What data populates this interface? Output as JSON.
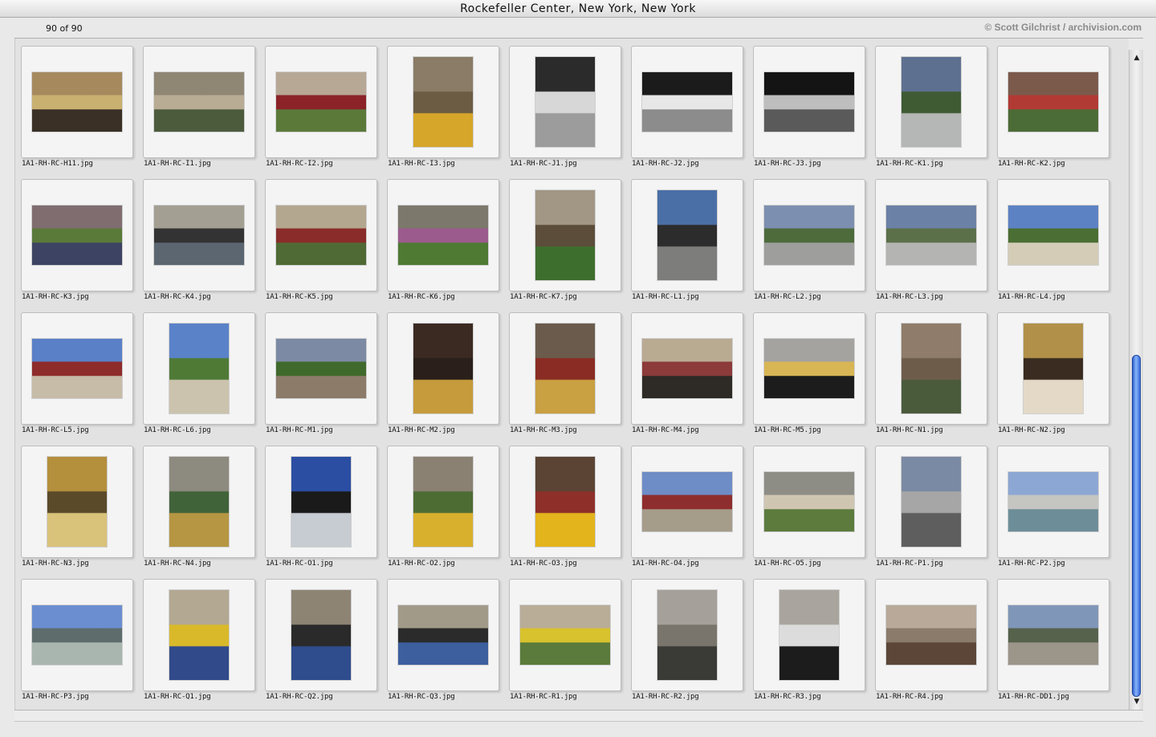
{
  "window": {
    "title": "Rockefeller Center, New York, New York"
  },
  "header": {
    "count": "90 of 90",
    "copyright": "© Scott Gilchrist / archivision.com"
  },
  "scrollbar": {
    "up_icon": "scroll-up-arrow-icon",
    "down_icon": "scroll-down-arrow-icon",
    "position": 0.82
  },
  "thumbnails": [
    {
      "filename": "1A1-RH-RC-H11.jpg",
      "orientation": "landscape",
      "colors": [
        "#a68a5e",
        "#3a3025",
        "#c9b070"
      ]
    },
    {
      "filename": "1A1-RH-RC-I1.jpg",
      "orientation": "landscape",
      "colors": [
        "#8f8674",
        "#4d5b3d",
        "#b9ac94"
      ]
    },
    {
      "filename": "1A1-RH-RC-I2.jpg",
      "orientation": "landscape",
      "colors": [
        "#b7a895",
        "#5b7a3a",
        "#8b2328"
      ]
    },
    {
      "filename": "1A1-RH-RC-I3.jpg",
      "orientation": "portrait",
      "colors": [
        "#8a7c66",
        "#d5a629",
        "#6b5c43"
      ]
    },
    {
      "filename": "1A1-RH-RC-J1.jpg",
      "orientation": "portrait",
      "colors": [
        "#2b2b2b",
        "#9c9c9c",
        "#d7d7d7"
      ]
    },
    {
      "filename": "1A1-RH-RC-J2.jpg",
      "orientation": "landscape",
      "colors": [
        "#1b1b1b",
        "#8c8c8c",
        "#e7e7e7"
      ]
    },
    {
      "filename": "1A1-RH-RC-J3.jpg",
      "orientation": "landscape",
      "colors": [
        "#141414",
        "#5a5a5a",
        "#bebebe"
      ]
    },
    {
      "filename": "1A1-RH-RC-K1.jpg",
      "orientation": "portrait",
      "colors": [
        "#5e7090",
        "#b5b6b6",
        "#3e5b33"
      ]
    },
    {
      "filename": "1A1-RH-RC-K2.jpg",
      "orientation": "landscape",
      "colors": [
        "#7c5a4b",
        "#4c6c37",
        "#b23a35"
      ]
    },
    {
      "filename": "1A1-RH-RC-K3.jpg",
      "orientation": "landscape",
      "colors": [
        "#7f6d6f",
        "#3d4463",
        "#5a7a3a"
      ]
    },
    {
      "filename": "1A1-RH-RC-K4.jpg",
      "orientation": "landscape",
      "colors": [
        "#a39f93",
        "#5b6671",
        "#333333"
      ]
    },
    {
      "filename": "1A1-RH-RC-K5.jpg",
      "orientation": "landscape",
      "colors": [
        "#b4a78f",
        "#4f6a35",
        "#8a2c2a"
      ]
    },
    {
      "filename": "1A1-RH-RC-K6.jpg",
      "orientation": "landscape",
      "colors": [
        "#7c786c",
        "#4e7a33",
        "#9c5b8d"
      ]
    },
    {
      "filename": "1A1-RH-RC-K7.jpg",
      "orientation": "portrait",
      "colors": [
        "#a29784",
        "#3e6e2e",
        "#5c4d3b"
      ]
    },
    {
      "filename": "1A1-RH-RC-L1.jpg",
      "orientation": "portrait",
      "colors": [
        "#4a6fa6",
        "#7d7d7c",
        "#2c2c2c"
      ]
    },
    {
      "filename": "1A1-RH-RC-L2.jpg",
      "orientation": "landscape",
      "colors": [
        "#7d8fb0",
        "#9e9f9c",
        "#4d6b3b"
      ]
    },
    {
      "filename": "1A1-RH-RC-L3.jpg",
      "orientation": "landscape",
      "colors": [
        "#6c81a6",
        "#b4b4b2",
        "#5b7049"
      ]
    },
    {
      "filename": "1A1-RH-RC-L4.jpg",
      "orientation": "landscape",
      "colors": [
        "#5d82c4",
        "#d4ccb7",
        "#4a6e33"
      ]
    },
    {
      "filename": "1A1-RH-RC-L5.jpg",
      "orientation": "landscape",
      "colors": [
        "#5a80c8",
        "#c7bca8",
        "#8e2b2b"
      ]
    },
    {
      "filename": "1A1-RH-RC-L6.jpg",
      "orientation": "portrait",
      "colors": [
        "#5a82c9",
        "#cbc3ad",
        "#4f7a36"
      ]
    },
    {
      "filename": "1A1-RH-RC-M1.jpg",
      "orientation": "landscape",
      "colors": [
        "#7c8aa3",
        "#8d7b69",
        "#3f6a2b"
      ]
    },
    {
      "filename": "1A1-RH-RC-M2.jpg",
      "orientation": "portrait",
      "colors": [
        "#3b2a22",
        "#c69b3b",
        "#2a1f1a"
      ]
    },
    {
      "filename": "1A1-RH-RC-M3.jpg",
      "orientation": "portrait",
      "colors": [
        "#6b5b4c",
        "#c9a042",
        "#8a2c24"
      ]
    },
    {
      "filename": "1A1-RH-RC-M4.jpg",
      "orientation": "landscape",
      "colors": [
        "#b9aa92",
        "#2e2a25",
        "#8c3a3a"
      ]
    },
    {
      "filename": "1A1-RH-RC-M5.jpg",
      "orientation": "landscape",
      "colors": [
        "#a5a3a0",
        "#1c1c1c",
        "#d8b655"
      ]
    },
    {
      "filename": "1A1-RH-RC-N1.jpg",
      "orientation": "portrait",
      "colors": [
        "#8f7c6a",
        "#4a5b3c",
        "#6e5c4b"
      ]
    },
    {
      "filename": "1A1-RH-RC-N2.jpg",
      "orientation": "portrait",
      "colors": [
        "#b19049",
        "#e3d9c6",
        "#3a2c20"
      ]
    },
    {
      "filename": "1A1-RH-RC-N3.jpg",
      "orientation": "portrait",
      "colors": [
        "#b48f3c",
        "#d9c27a",
        "#5a4a2a"
      ]
    },
    {
      "filename": "1A1-RH-RC-N4.jpg",
      "orientation": "portrait",
      "colors": [
        "#8d8a7f",
        "#b69643",
        "#41633a"
      ]
    },
    {
      "filename": "1A1-RH-RC-O1.jpg",
      "orientation": "portrait",
      "colors": [
        "#2b4ea3",
        "#c7cbd2",
        "#1a1a1a"
      ]
    },
    {
      "filename": "1A1-RH-RC-O2.jpg",
      "orientation": "portrait",
      "colors": [
        "#8a8172",
        "#d9b02e",
        "#4d6c34"
      ]
    },
    {
      "filename": "1A1-RH-RC-O3.jpg",
      "orientation": "portrait",
      "colors": [
        "#5b4433",
        "#e3b41c",
        "#8e2f2a"
      ]
    },
    {
      "filename": "1A1-RH-RC-O4.jpg",
      "orientation": "landscape",
      "colors": [
        "#6e8cc6",
        "#a69c8a",
        "#8e2d2d"
      ]
    },
    {
      "filename": "1A1-RH-RC-O5.jpg",
      "orientation": "landscape",
      "colors": [
        "#8d8d86",
        "#5c7b3d",
        "#cfc6b2"
      ]
    },
    {
      "filename": "1A1-RH-RC-P1.jpg",
      "orientation": "portrait",
      "colors": [
        "#7b8aa4",
        "#5e5e5e",
        "#a6a6a6"
      ]
    },
    {
      "filename": "1A1-RH-RC-P2.jpg",
      "orientation": "landscape",
      "colors": [
        "#8ca7d3",
        "#6d8e99",
        "#c5c5c2"
      ]
    },
    {
      "filename": "1A1-RH-RC-P3.jpg",
      "orientation": "landscape",
      "colors": [
        "#6b8ed1",
        "#a9b6b0",
        "#5e6c6c"
      ]
    },
    {
      "filename": "1A1-RH-RC-Q1.jpg",
      "orientation": "portrait",
      "colors": [
        "#b3a892",
        "#314a8a",
        "#d9b92a"
      ]
    },
    {
      "filename": "1A1-RH-RC-Q2.jpg",
      "orientation": "portrait",
      "colors": [
        "#8e8474",
        "#2f4c8d",
        "#2a2a2a"
      ]
    },
    {
      "filename": "1A1-RH-RC-Q3.jpg",
      "orientation": "landscape",
      "colors": [
        "#a29a89",
        "#3d5f9e",
        "#2b2b2b"
      ]
    },
    {
      "filename": "1A1-RH-RC-R1.jpg",
      "orientation": "landscape",
      "colors": [
        "#b9ad98",
        "#5a7b3b",
        "#d8c22d"
      ]
    },
    {
      "filename": "1A1-RH-RC-R2.jpg",
      "orientation": "portrait",
      "colors": [
        "#a6a09a",
        "#3a3a36",
        "#7a756c"
      ]
    },
    {
      "filename": "1A1-RH-RC-R3.jpg",
      "orientation": "portrait",
      "colors": [
        "#a9a59e",
        "#1c1c1c",
        "#dcdcdc"
      ]
    },
    {
      "filename": "1A1-RH-RC-R4.jpg",
      "orientation": "landscape",
      "colors": [
        "#b8a998",
        "#5b4637",
        "#8a7b6a"
      ]
    },
    {
      "filename": "1A1-RH-RC-DD1.jpg",
      "orientation": "landscape",
      "colors": [
        "#7f96b8",
        "#9b958a",
        "#56624c"
      ]
    }
  ]
}
